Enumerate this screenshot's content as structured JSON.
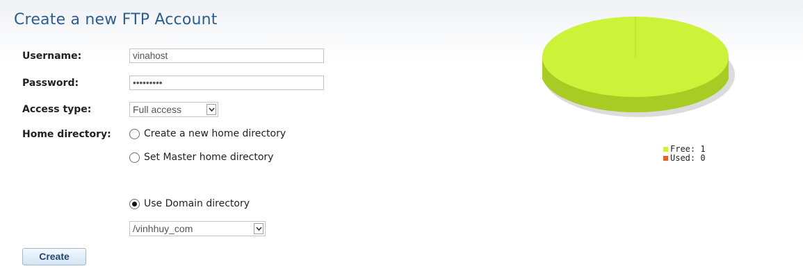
{
  "form": {
    "title": "Create a new FTP Account",
    "username_label": "Username:",
    "username_value": "vinahost",
    "password_label": "Password:",
    "password_value": "vinahost1",
    "access_label": "Access type:",
    "access_value": "Full access",
    "home_label": "Home directory:",
    "home_options": [
      {
        "label": "Create a new home directory",
        "selected": false
      },
      {
        "label": "Set Master home directory",
        "selected": false
      },
      {
        "label": "Use Domain directory",
        "selected": true
      }
    ],
    "domain_dir_value": "/vinhhuy_com",
    "create_button": "Create"
  },
  "chart_data": {
    "type": "pie",
    "slices": [
      {
        "name": "Free",
        "value": 1,
        "color": "#ccf23a"
      },
      {
        "name": "Used",
        "value": 0,
        "color": "#e8612c"
      }
    ],
    "legend": [
      {
        "label": "Free: 1",
        "color": "#ccf23a"
      },
      {
        "label": "Used: 0",
        "color": "#e8612c"
      }
    ],
    "legend_position": "bottom-right"
  }
}
